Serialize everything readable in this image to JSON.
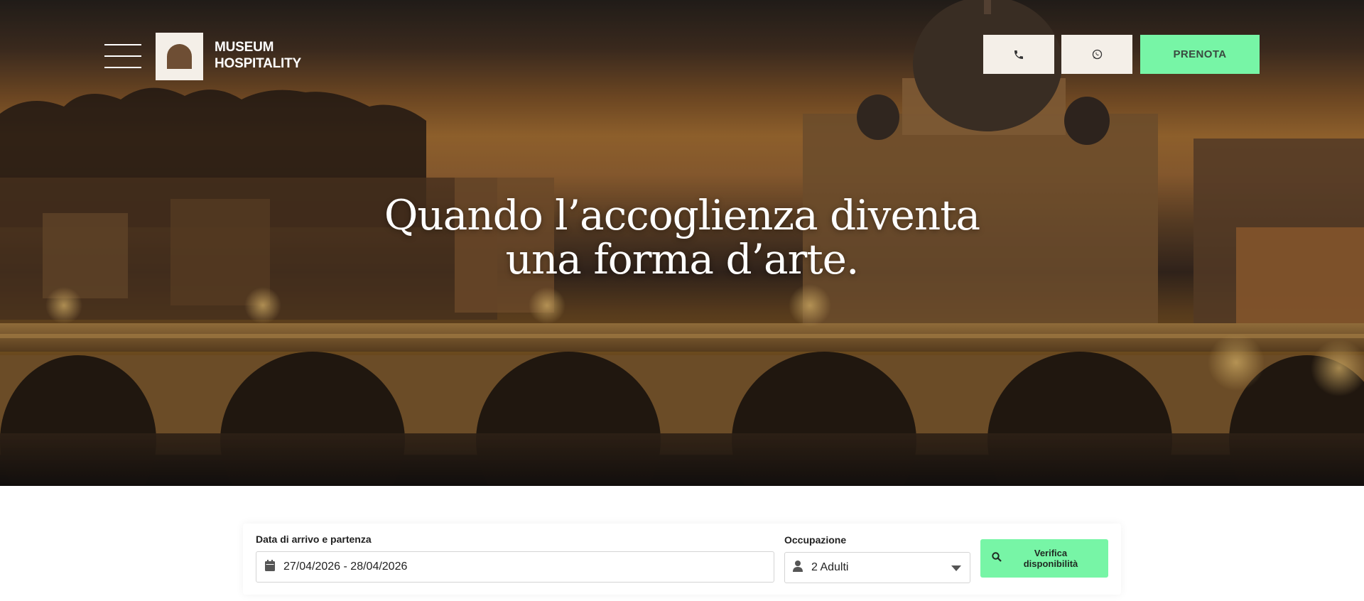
{
  "header": {
    "logo_line1": "MUSEUM",
    "logo_line2": "HOSPITALITY",
    "book_label": "PRENOTA",
    "icons": {
      "menu": "hamburger-menu-icon",
      "phone": "phone-icon",
      "whatsapp": "whatsapp-icon"
    }
  },
  "hero": {
    "headline_line1": "Quando l’accoglienza diventa",
    "headline_line2": "una forma d’arte."
  },
  "booking": {
    "date_label": "Data di arrivo e partenza",
    "date_value": "27/04/2026 - 28/04/2026",
    "occupancy_label": "Occupazione",
    "occupancy_value": "2 Adulti",
    "verify_line1": "Verifica",
    "verify_line2": "disponibilità",
    "icons": {
      "date": "calendar-icon",
      "occupancy": "person-icon",
      "select": "chevron-down-icon",
      "verify": "search-icon"
    }
  },
  "colors": {
    "accent_green": "#77f5a6",
    "cream": "#f4efe8",
    "logo_brown": "#6e4e34"
  }
}
